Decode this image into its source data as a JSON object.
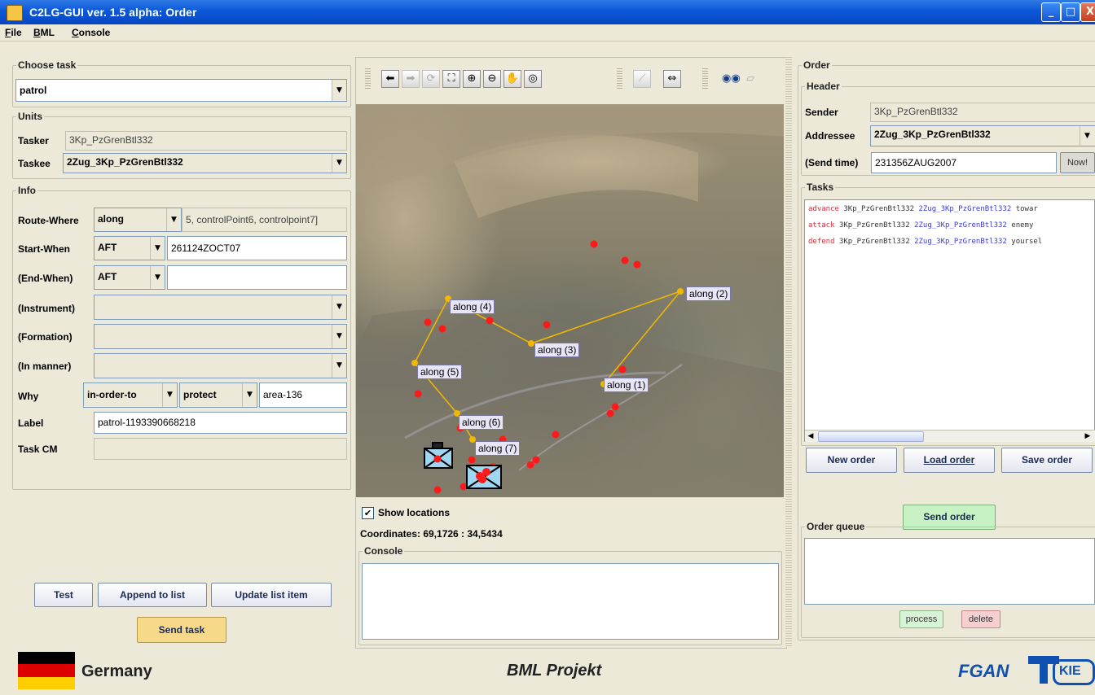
{
  "window": {
    "title": "C2LG-GUI ver. 1.5 alpha: Order"
  },
  "menu": [
    "File",
    "BML",
    "Console"
  ],
  "left": {
    "choose_task": {
      "title": "Choose task",
      "value": "patrol"
    },
    "units": {
      "title": "Units",
      "tasker_label": "Tasker",
      "tasker_value": "3Kp_PzGrenBtl332",
      "taskee_label": "Taskee",
      "taskee_value": "2Zug_3Kp_PzGrenBtl332"
    },
    "info": {
      "title": "Info",
      "route_where": {
        "label": "Route-Where",
        "combo": "along",
        "value": "5, controlPoint6, controlpoint7]"
      },
      "start_when": {
        "label": "Start-When",
        "combo": "AFT",
        "value": "261124ZOCT07"
      },
      "end_when": {
        "label": "(End-When)",
        "combo": "AFT",
        "value": ""
      },
      "instrument": {
        "label": "(Instrument)"
      },
      "formation": {
        "label": "(Formation)"
      },
      "in_manner": {
        "label": "(In manner)"
      },
      "why": {
        "label": "Why",
        "combo1": "in-order-to",
        "combo2": "protect",
        "value": "area-136"
      },
      "label": {
        "label": "Label",
        "value": "patrol-1193390668218"
      },
      "task_cm": {
        "label": "Task CM",
        "value": ""
      }
    },
    "buttons": {
      "test": "Test",
      "append": "Append to list",
      "update": "Update list item",
      "send_task": "Send task"
    }
  },
  "map": {
    "labels": [
      "along (1)",
      "along (2)",
      "along (3)",
      "along (4)",
      "along (5)",
      "along (6)",
      "along (7)"
    ],
    "show_locations": "Show locations",
    "coordinates": "Coordinates: 69,1726 : 34,5434",
    "console_title": "Console"
  },
  "order": {
    "title": "Order",
    "header_title": "Header",
    "sender_label": "Sender",
    "sender_value": "3Kp_PzGrenBtl332",
    "addressee_label": "Addressee",
    "addressee_value": "2Zug_3Kp_PzGrenBtl332",
    "send_time_label": "(Send time)",
    "send_time_value": "231356ZAUG2007",
    "now_button": "Now!",
    "tasks_title": "Tasks",
    "tasks": [
      {
        "kw": "advance",
        "u1": "3Kp_PzGrenBtl332",
        "u2": "2Zug_3Kp_PzGrenBtl332",
        "rest": "towar"
      },
      {
        "kw": "attack",
        "u1": "3Kp_PzGrenBtl332",
        "u2": "2Zug_3Kp_PzGrenBtl332",
        "rest": "enemy"
      },
      {
        "kw": "defend",
        "u1": "3Kp_PzGrenBtl332",
        "u2": "2Zug_3Kp_PzGrenBtl332",
        "rest": "yoursel"
      }
    ],
    "new_order": "New order",
    "load_order": "Load order",
    "save_order": "Save order",
    "send_order": "Send order",
    "queue_title": "Order queue",
    "process": "process",
    "delete": "delete"
  },
  "footer": {
    "country": "Germany",
    "project": "BML Projekt",
    "org": "FGAN",
    "org2": "KIE"
  },
  "colors": {
    "accent_send_task": "#f7d98a",
    "accent_send_order": "#c7f2c3",
    "process_bg": "#d8f4d6",
    "delete_bg": "#f6cfd0"
  }
}
